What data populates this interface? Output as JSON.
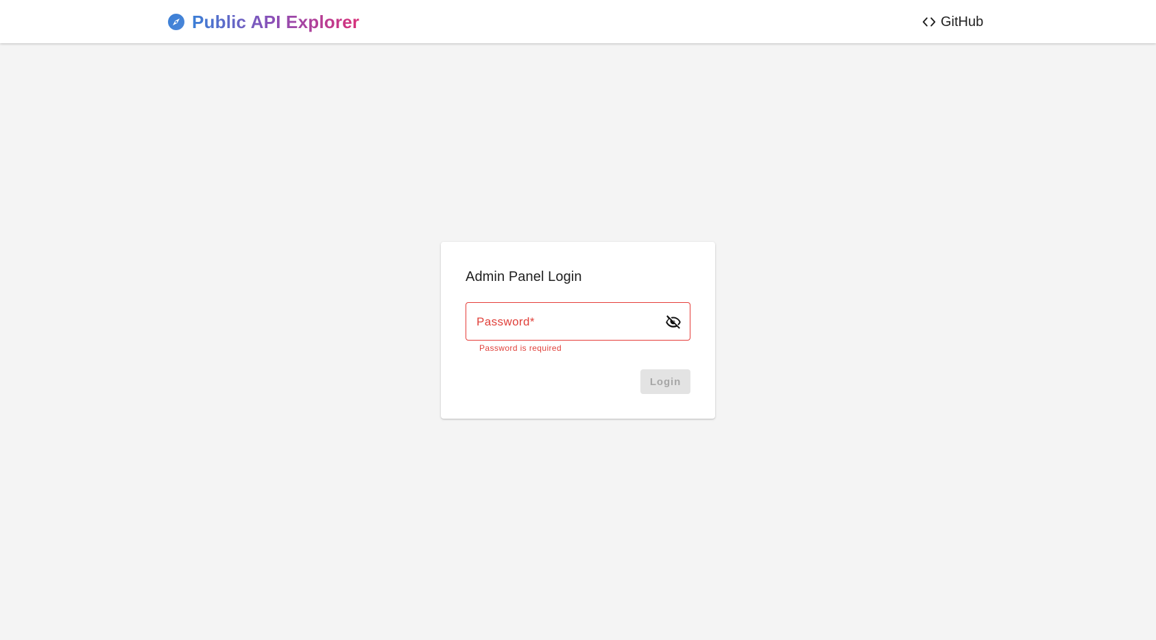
{
  "header": {
    "brand_title": "Public API Explorer",
    "brand_icon": "compass-icon",
    "github_label": "GitHub",
    "github_icon": "code-icon"
  },
  "login": {
    "title": "Admin Panel Login",
    "password_label": "Password*",
    "password_value": "",
    "password_error": "Password is required",
    "visibility_icon": "eye-off-icon",
    "login_label": "Login",
    "login_enabled": false
  },
  "colors": {
    "background": "#f4f4f4",
    "error": "#e53935",
    "brand_gradient_start": "#3b7fd6",
    "brand_gradient_mid": "#8b4fb7",
    "brand_gradient_end": "#d8317a",
    "disabled_button_bg": "#e3e3e3",
    "disabled_button_text": "#a6a6a6"
  }
}
